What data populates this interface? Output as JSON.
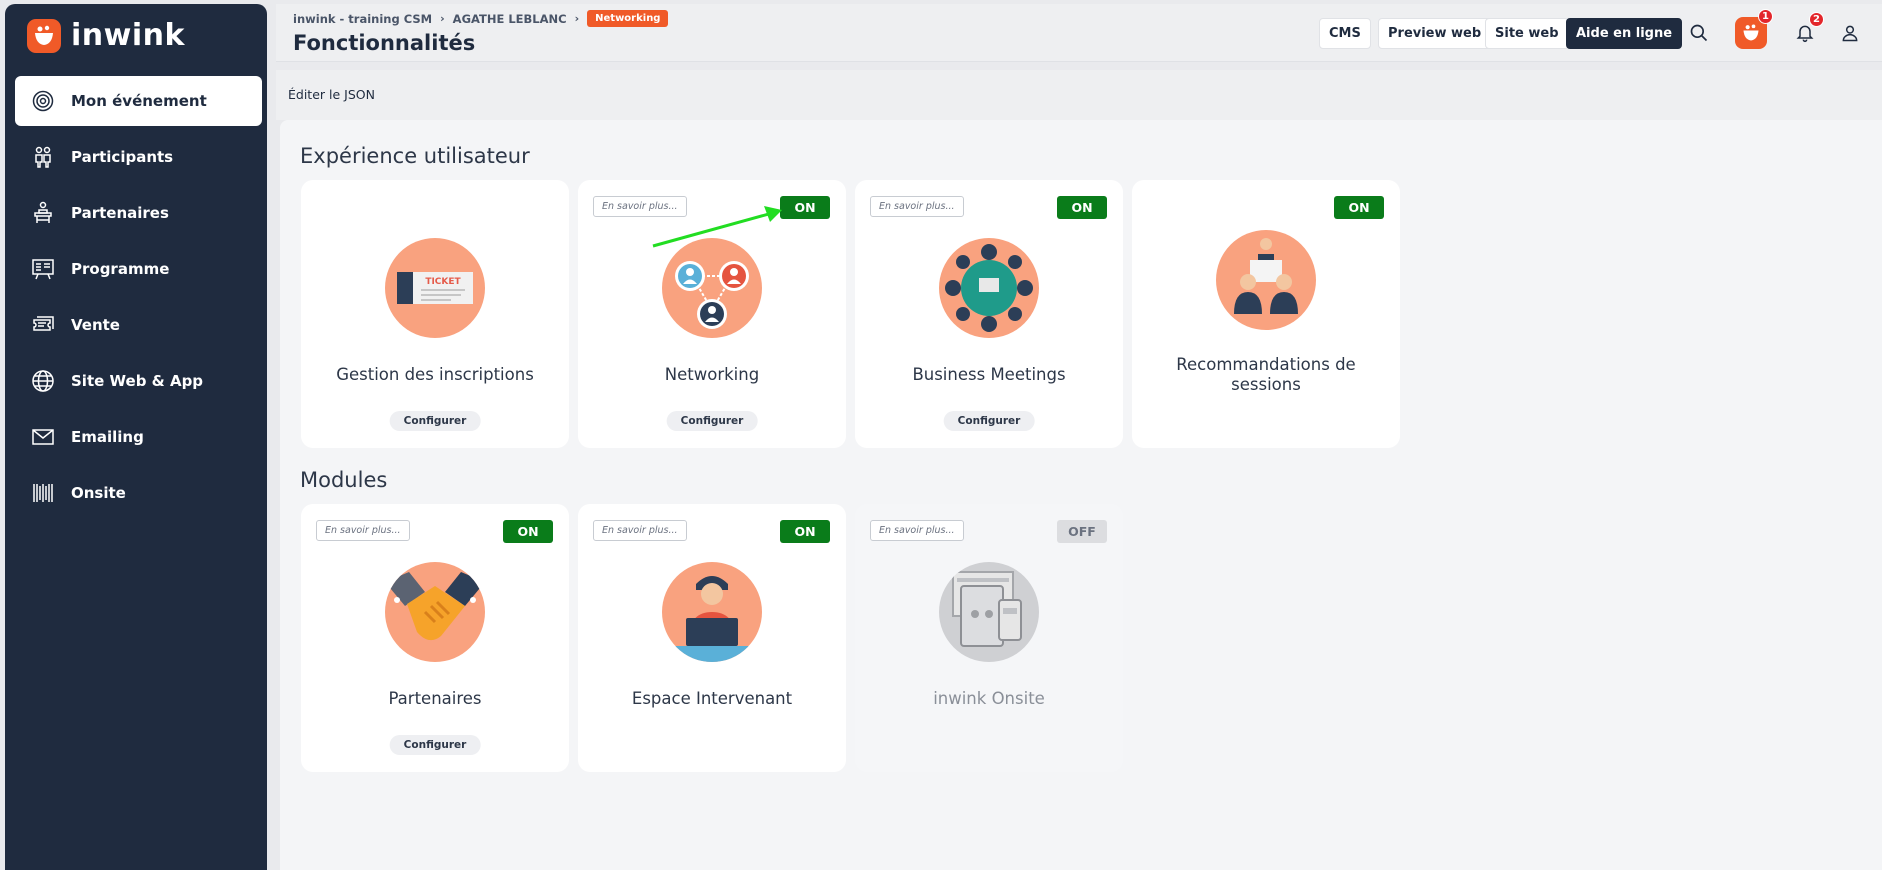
{
  "brand": {
    "name": "inwink",
    "accent": "#f05a28",
    "sidebar_bg": "#1f2b3f",
    "on_color": "#0a7c1a"
  },
  "sidebar": {
    "items": [
      {
        "label": "Mon événement",
        "icon": "event-target-icon",
        "active": true
      },
      {
        "label": "Participants",
        "icon": "participants-icon"
      },
      {
        "label": "Partenaires",
        "icon": "partners-podium-icon"
      },
      {
        "label": "Programme",
        "icon": "program-board-icon"
      },
      {
        "label": "Vente",
        "icon": "tickets-icon"
      },
      {
        "label": "Site Web & App",
        "icon": "globe-icon"
      },
      {
        "label": "Emailing",
        "icon": "mail-icon"
      },
      {
        "label": "Onsite",
        "icon": "barcode-icon"
      }
    ]
  },
  "header": {
    "breadcrumb": [
      "inwink - training CSM",
      "AGATHE LEBLANC",
      "Networking"
    ],
    "title": "Fonctionnalités",
    "buttons": {
      "cms": "CMS",
      "preview": "Preview web",
      "site": "Site web",
      "help": "Aide en ligne"
    },
    "badges": {
      "inwink": "1",
      "notifications": "2"
    }
  },
  "subbar": {
    "json_link": "Éditer le JSON"
  },
  "sections": {
    "ux": {
      "title": "Expérience utilisateur",
      "cards": [
        {
          "title": "Gestion des inscriptions",
          "configure": "Configurer",
          "illustration": "ticket-icon",
          "illus_text": "TICKET"
        },
        {
          "title": "Networking",
          "learn": "En savoir plus...",
          "toggle": "ON",
          "configure": "Configurer",
          "illustration": "networking-people-icon"
        },
        {
          "title": "Business Meetings",
          "learn": "En savoir plus...",
          "toggle": "ON",
          "configure": "Configurer",
          "illustration": "meeting-table-icon"
        },
        {
          "title": "Recommandations de sessions",
          "toggle": "ON",
          "illustration": "presenter-audience-icon"
        }
      ]
    },
    "modules": {
      "title": "Modules",
      "cards": [
        {
          "title": "Partenaires",
          "learn": "En savoir plus...",
          "toggle": "ON",
          "configure": "Configurer",
          "illustration": "handshake-icon"
        },
        {
          "title": "Espace Intervenant",
          "learn": "En savoir plus...",
          "toggle": "ON",
          "illustration": "speaker-laptop-icon"
        },
        {
          "title": "inwink Onsite",
          "learn": "En savoir plus...",
          "toggle": "OFF",
          "illustration": "devices-icon"
        }
      ]
    }
  }
}
